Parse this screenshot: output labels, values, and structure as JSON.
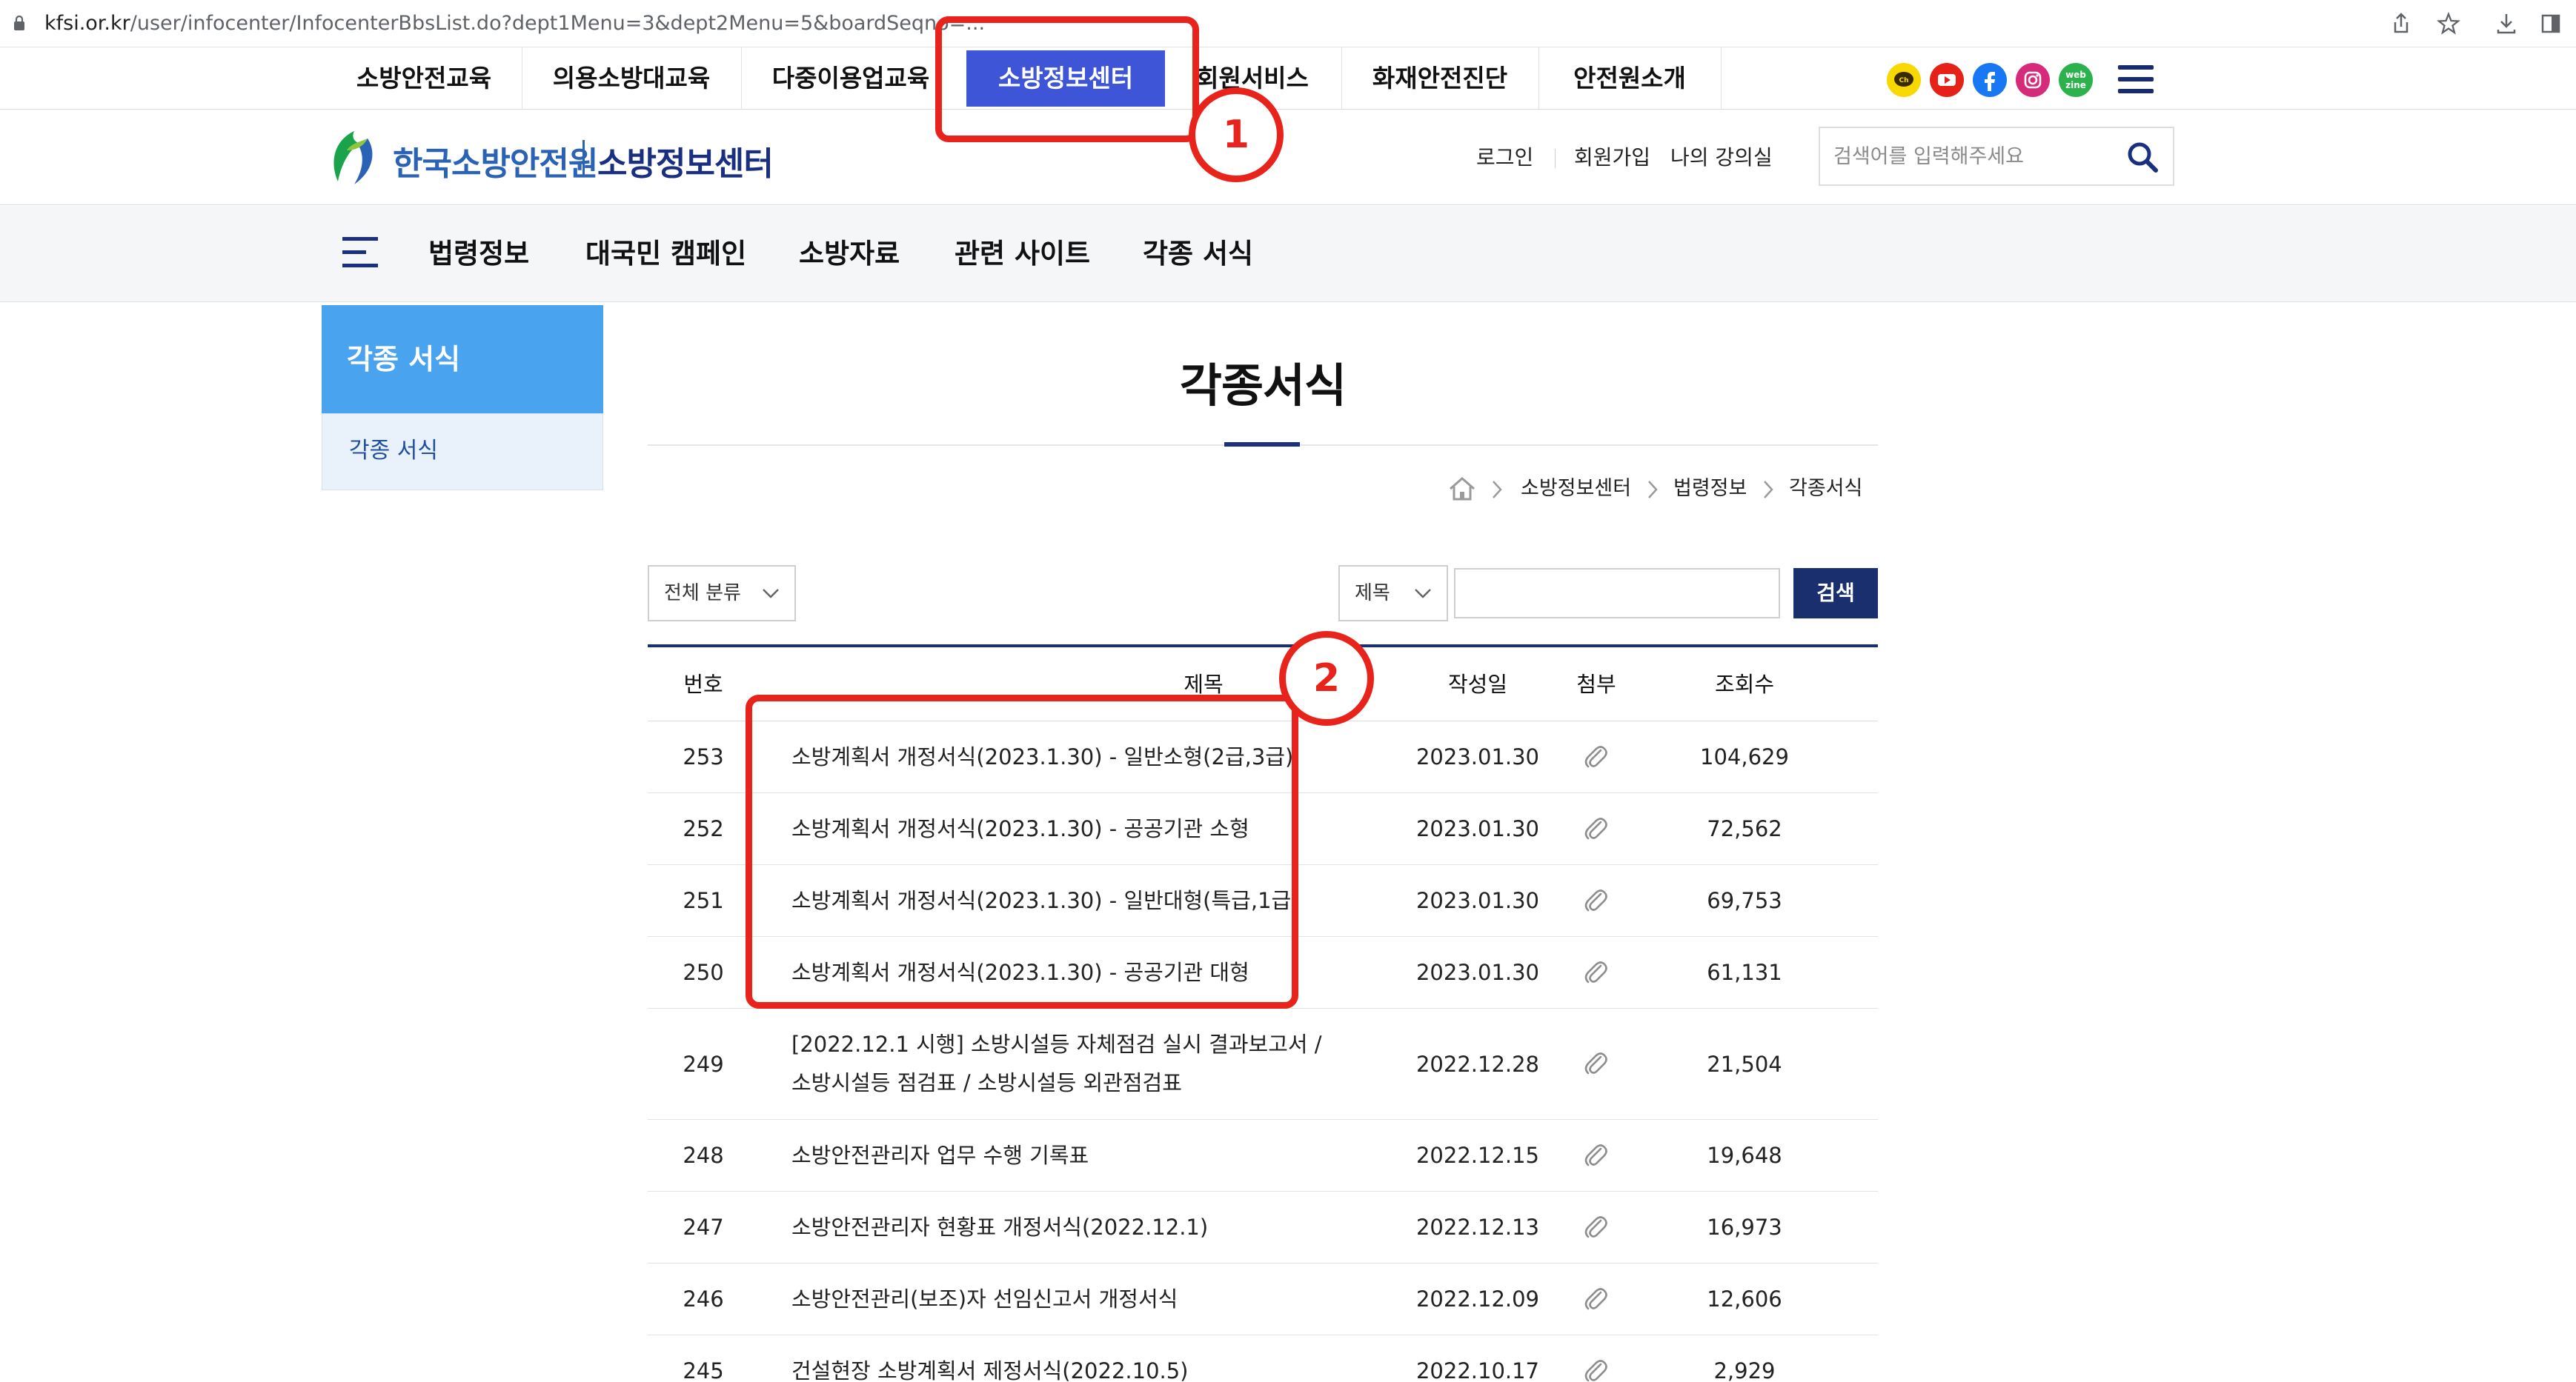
{
  "browser": {
    "url_domain": "kfsi.or.kr",
    "url_path": "/user/infocenter/InfocenterBbsList.do?dept1Menu=3&dept2Menu=5&boardSeqno=..."
  },
  "topnav": {
    "items": [
      "소방안전교육",
      "의용소방대교육",
      "다중이용업교육",
      "소방정보센터",
      "회원서비스",
      "화재안전진단",
      "안전원소개"
    ],
    "active_index": 3,
    "social": [
      "kakao-icon",
      "youtube-icon",
      "facebook-icon",
      "instagram-icon",
      "webzine-icon"
    ],
    "webzine_text": "web zine"
  },
  "header": {
    "logo_text": "한국소방안전원",
    "logo_sub": "소방정보센터",
    "links": [
      "로그인",
      "회원가입",
      "나의 강의실"
    ],
    "search_placeholder": "검색어를 입력해주세요"
  },
  "subnav": {
    "items": [
      "법령정보",
      "대국민 캠페인",
      "소방자료",
      "관련 사이트",
      "각종 서식"
    ]
  },
  "sidebar": {
    "title": "각종 서식",
    "items": [
      "각종 서식"
    ]
  },
  "main": {
    "title": "각종서식",
    "breadcrumb": [
      "소방정보센터",
      "법령정보",
      "각종서식"
    ],
    "filter": {
      "category": "전체 분류",
      "field": "제목",
      "keyword": "",
      "search_label": "검색"
    },
    "columns": [
      "번호",
      "제목",
      "작성일",
      "첨부",
      "조회수"
    ],
    "rows": [
      {
        "no": "253",
        "title": "소방계획서 개정서식(2023.1.30) - 일반소형(2급,3급)",
        "date": "2023.01.30",
        "views": "104,629"
      },
      {
        "no": "252",
        "title": "소방계획서 개정서식(2023.1.30) - 공공기관 소형",
        "date": "2023.01.30",
        "views": "72,562"
      },
      {
        "no": "251",
        "title": "소방계획서 개정서식(2023.1.30) - 일반대형(특급,1급)",
        "date": "2023.01.30",
        "views": "69,753"
      },
      {
        "no": "250",
        "title": "소방계획서 개정서식(2023.1.30) - 공공기관 대형",
        "date": "2023.01.30",
        "views": "61,131"
      },
      {
        "no": "249",
        "title": "[2022.12.1 시행] 소방시설등 자체점검 실시 결과보고서 /",
        "title2": "소방시설등 점검표 / 소방시설등 외관점검표",
        "date": "2022.12.28",
        "views": "21,504"
      },
      {
        "no": "248",
        "title": "소방안전관리자 업무 수행 기록표",
        "date": "2022.12.15",
        "views": "19,648"
      },
      {
        "no": "247",
        "title": "소방안전관리자 현황표 개정서식(2022.12.1)",
        "date": "2022.12.13",
        "views": "16,973"
      },
      {
        "no": "246",
        "title": "소방안전관리(보조)자 선임신고서 개정서식",
        "date": "2022.12.09",
        "views": "12,606"
      },
      {
        "no": "245",
        "title": "건설현장 소방계획서 제정서식(2022.10.5)",
        "date": "2022.10.17",
        "views": "2,929"
      }
    ]
  },
  "annotations": [
    "1",
    "2"
  ],
  "colors": {
    "active_nav": "#3d55d6",
    "navy": "#1a2f6e",
    "side_blue": "#4aa3ee",
    "annotation_red": "#e8231b"
  }
}
